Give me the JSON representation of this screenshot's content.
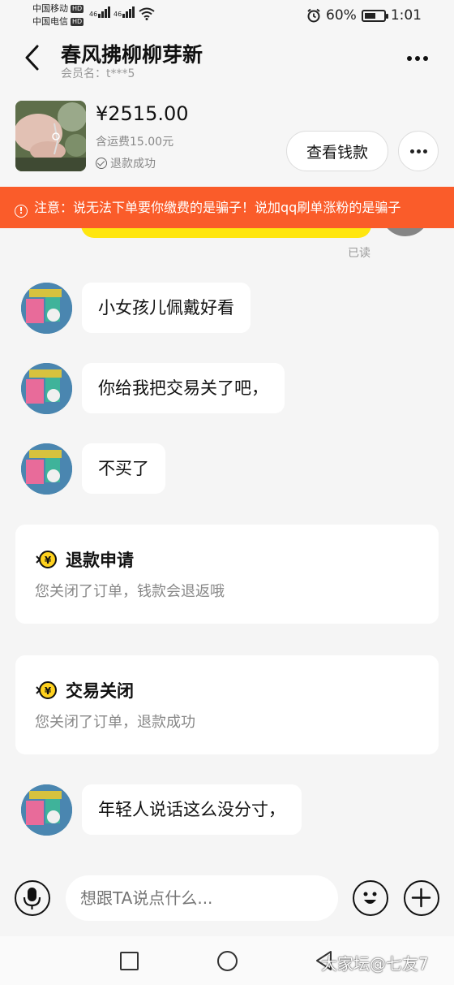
{
  "status_bar": {
    "carrier1": "中国移动",
    "carrier2": "中国电信",
    "hd": "HD",
    "net1": "46",
    "net2": "46",
    "battery": "60%",
    "battery_level": 0.6,
    "time": "1:01"
  },
  "header": {
    "title": "春风拂柳柳芽新",
    "member": "会员名：t***5"
  },
  "product": {
    "price": "¥2515.00",
    "shipping": "含运费15.00元",
    "refund_status": "退款成功",
    "view_payment": "查看钱款"
  },
  "notice": {
    "icon": "!",
    "text": "注意：说无法下单要你缴费的是骗子！说加qq刷单涨粉的是骗子"
  },
  "chat": {
    "read_label": "已读",
    "messages": [
      {
        "text": "小女孩儿佩戴好看"
      },
      {
        "text": "你给我把交易关了吧，"
      },
      {
        "text": "不买了"
      }
    ],
    "cards": [
      {
        "title": "退款申请",
        "desc": "您关闭了订单，钱款会退返哦"
      },
      {
        "title": "交易关闭",
        "desc": "您关闭了订单，退款成功"
      }
    ],
    "last_message": "年轻人说话这么没分寸，"
  },
  "input": {
    "placeholder": "想跟TA说点什么..."
  },
  "watermark": "大家坛@七友7",
  "colors": {
    "notice_bg": "#fa5c2a",
    "accent_yellow": "#ffe60f",
    "background": "#f5f5f5"
  }
}
